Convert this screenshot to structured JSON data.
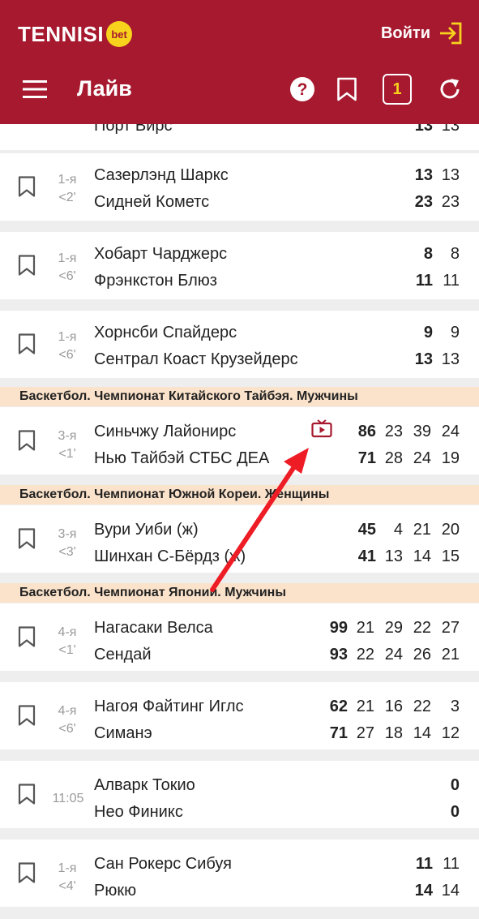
{
  "header": {
    "logo_text": "TENNISI",
    "logo_badge": "bet",
    "login_label": "Войти",
    "page_title": "Лайв",
    "coupon_count": "1"
  },
  "colors": {
    "brand": "#a6192e",
    "accent": "#f7d31d",
    "league_bg": "#fbe3cb",
    "annotation_arrow": "#ee1c25"
  },
  "icons": [
    "menu-icon",
    "help-icon",
    "bookmark-icon",
    "coupon-icon",
    "refresh-icon",
    "login-icon",
    "tv-icon"
  ],
  "events": [
    {
      "period": "",
      "time": "",
      "team1": "Порт Вирс",
      "team2": "",
      "scores1": [
        "13",
        "13"
      ],
      "scores2": []
    },
    {
      "period": "1-я",
      "time": "<2'",
      "team1": "Сазерлэнд Шаркс",
      "team2": "Сидней Кометс",
      "scores1": [
        "13",
        "13"
      ],
      "scores2": [
        "23",
        "23"
      ]
    },
    {
      "period": "1-я",
      "time": "<6'",
      "team1": "Хобарт Чарджерс",
      "team2": "Фрэнкстон Блюз",
      "scores1": [
        "8",
        "8"
      ],
      "scores2": [
        "11",
        "11"
      ]
    },
    {
      "period": "1-я",
      "time": "<6'",
      "team1": "Хорнсби Спайдерс",
      "team2": "Сентрал Коаст Крузейдерс",
      "scores1": [
        "9",
        "9"
      ],
      "scores2": [
        "13",
        "13"
      ]
    },
    {
      "period": "3-я",
      "time": "<1'",
      "team1": "Синьчжу Лайонирс",
      "team2": "Нью Тайбэй СТБС ДЕА",
      "scores1": [
        "86",
        "23",
        "39",
        "24"
      ],
      "scores2": [
        "71",
        "28",
        "24",
        "19"
      ]
    },
    {
      "period": "3-я",
      "time": "<3'",
      "team1": "Вури Уиби (ж)",
      "team2": "Шинхан С-Бёрдз (ж)",
      "scores1": [
        "45",
        "4",
        "21",
        "20"
      ],
      "scores2": [
        "41",
        "13",
        "14",
        "15"
      ]
    },
    {
      "period": "4-я",
      "time": "<1'",
      "team1": "Нагасаки Велса",
      "team2": "Сендай",
      "scores1": [
        "99",
        "21",
        "29",
        "22",
        "27"
      ],
      "scores2": [
        "93",
        "22",
        "24",
        "26",
        "21"
      ]
    },
    {
      "period": "4-я",
      "time": "<6'",
      "team1": "Нагоя Файтинг Иглс",
      "team2": "Симанэ",
      "scores1": [
        "62",
        "21",
        "16",
        "22",
        "3"
      ],
      "scores2": [
        "71",
        "27",
        "18",
        "14",
        "12"
      ]
    },
    {
      "period": "11:05",
      "time": "",
      "team1": "Алварк Токио",
      "team2": "Нео Финикс",
      "scores1": [
        "0"
      ],
      "scores2": [
        "0"
      ]
    },
    {
      "period": "1-я",
      "time": "<4'",
      "team1": "Сан Рокерс Сибуя",
      "team2": "Рюкю",
      "scores1": [
        "11",
        "11"
      ],
      "scores2": [
        "14",
        "14"
      ]
    }
  ],
  "leagues": [
    "Баскетбол. Чемпионат Китайского Тайбэя. Мужчины",
    "Баскетбол. Чемпионат Южной Кореи. Женщины",
    "Баскетбол. Чемпионат Японии. Мужчины"
  ]
}
